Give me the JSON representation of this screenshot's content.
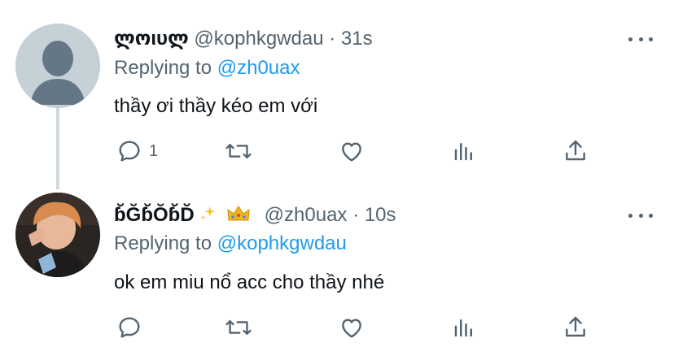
{
  "tweets": [
    {
      "display_name": "ლოιυლ",
      "handle": "@kophkgwdau",
      "separator": "·",
      "time": "31s",
      "replying_prefix": "Replying to",
      "replying_to": "@zh0uax",
      "text": "thầy ơi thầy kéo em với",
      "reply_count": "1",
      "retweet_count": "",
      "like_count": "",
      "icons": [
        "reply-icon",
        "retweet-icon",
        "like-icon",
        "analytics-icon",
        "share-icon",
        "more-icon"
      ]
    },
    {
      "display_name": "ɓ̆Ğɓ̆Ŏɓ̆D̆",
      "handle": "@zh0uax",
      "separator": "·",
      "time": "10s",
      "replying_prefix": "Replying to",
      "replying_to": "@kophkgwdau",
      "text": "ok em miu nổ acc cho thầy nhé",
      "reply_count": "",
      "retweet_count": "",
      "like_count": "",
      "icons": [
        "sparkles-icon",
        "crown-icon",
        "reply-icon",
        "retweet-icon",
        "like-icon",
        "analytics-icon",
        "share-icon",
        "more-icon"
      ]
    }
  ],
  "colors": {
    "text": "#0f1419",
    "secondary": "#536471",
    "accent": "#1d9bf0",
    "thread_line": "#cfd9de",
    "avatar_placeholder": "#c6d0d7"
  }
}
